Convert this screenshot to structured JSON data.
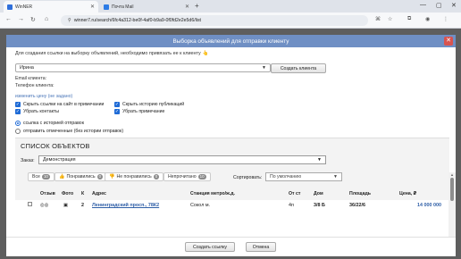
{
  "browser": {
    "tabs": [
      {
        "title": "WinNER",
        "active": true
      },
      {
        "title": "Почта Mail",
        "active": false
      }
    ],
    "url": "winner7.ru/search/6fc4a312-be0f-4af0-b9a9-0f0fd2e2e5d6/list",
    "colors": {
      "tab_favicon_1": "#2f6fdb",
      "tab_favicon_2": "#2c7be5"
    }
  },
  "modal": {
    "title": "Выборка объявлений для отправки клиенту",
    "intro": "Для создания ссылки на выборку объявлений, необходимо привязать ее к клиенту",
    "intro_emoji": "👆",
    "client_value": "Ирина",
    "create_client_button": "Создать клиента",
    "email_label": "Email клиента:",
    "phone_label": "Телефон клиента:",
    "price_link": "изменить цену (не задано)",
    "checkboxes": [
      {
        "label": "Скрыть ссылки на сайт в примечании",
        "checked": true
      },
      {
        "label": "Скрыть историю публикаций",
        "checked": true
      },
      {
        "label": "Убрать контакты",
        "checked": true
      },
      {
        "label": "Убрать примечание",
        "checked": true
      }
    ],
    "radios": [
      {
        "label": "ссылка с историей отправок",
        "selected": true
      },
      {
        "label": "отправить отмеченные (без истории отправок)",
        "selected": false
      }
    ],
    "objects": {
      "title": "СПИСОК ОБЪЕКТОВ",
      "order_label": "Заказ:",
      "order_value": "Демонстрация",
      "filters": [
        {
          "label": "Все",
          "count": "10"
        },
        {
          "label": "Понравились",
          "count": "0"
        },
        {
          "label": "Не понравились",
          "count": "0"
        },
        {
          "label": "Непрочитано",
          "count": "10"
        }
      ],
      "sort_label": "Сортировать:",
      "sort_value": "По умолчанию",
      "columns": [
        "Отзыв",
        "Фото",
        "К",
        "Адрес",
        "Станция метро/ж.д.",
        "От ст",
        "Дом",
        "Площадь",
        "Цена, ₽"
      ],
      "rows": [
        {
          "k": "2",
          "address": "Ленинградский просп., 78К2",
          "station": "Сокол м.",
          "from_st": "4п",
          "house": "3/8 Б",
          "area": "36/22/6",
          "price": "14 000 000"
        }
      ]
    },
    "submit_button": "Создать ссылку",
    "cancel_button": "Отмена"
  }
}
